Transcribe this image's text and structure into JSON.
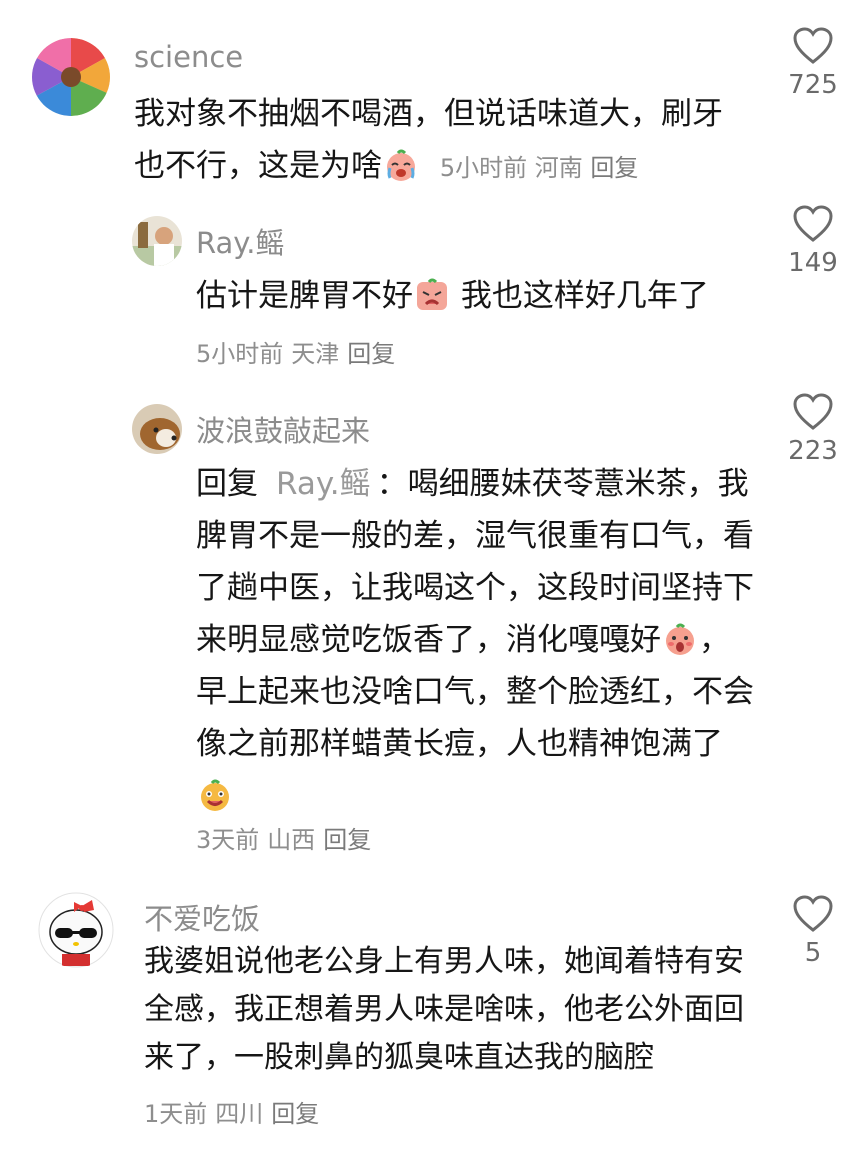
{
  "comments": [
    {
      "user": "science",
      "text_before": "我对象不抽烟不喝酒，但说话味道大，刷牙也不行，这是为啥",
      "emoji": "crying-face-emoji",
      "time": "5小时前",
      "location": "河南",
      "reply_label": "回复",
      "likes": "725"
    },
    {
      "user": "Ray.鳐",
      "text_before": "估计是脾胃不好",
      "emoji": "sad-face-emoji",
      "text_after": " 我也这样好几年了",
      "time": "5小时前",
      "location": "天津",
      "reply_label": "回复",
      "likes": "149"
    },
    {
      "user": "波浪鼓敲起来",
      "reply_prefix": "回复",
      "reply_to": "Ray.鳐",
      "text_before": "：喝细腰妹茯苓薏米茶，我脾胃不是一般的差，湿气很重有口气，看了趟中医，让我喝这个，这段时间坚持下来明显感觉吃饭香了，消化嘎嘎好",
      "emoji": "surprised-face-emoji",
      "text_mid": "，早上起来也没啥口气，整个脸透红，不会像之前那样蜡黄长痘，人也精神饱满了",
      "emoji2": "happy-face-emoji",
      "time": "3天前",
      "location": "山西",
      "reply_label": "回复",
      "likes": "223"
    },
    {
      "user": "不爱吃饭",
      "text_before": "我婆姐说他老公身上有男人味，她闻着特有安全感，我正想着男人味是啥味，他老公外面回来了，一股刺鼻的狐臭味直达我的脑腔",
      "time": "1天前",
      "location": "四川",
      "reply_label": "回复",
      "likes": "5"
    }
  ],
  "icons": {
    "like": "heart-outline-icon"
  }
}
